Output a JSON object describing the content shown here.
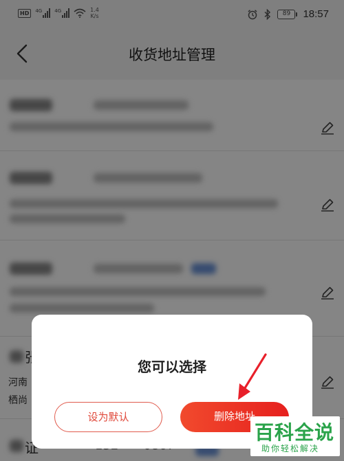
{
  "status_bar": {
    "hd_badge": "HD",
    "net1_tag": "4G",
    "net2_tag": "4G",
    "speed_value": "1.4",
    "speed_unit": "K/s",
    "battery_level": "89",
    "time": "18:57",
    "icons": [
      "hd-icon",
      "signal-icon",
      "wifi-icon",
      "alarm-icon",
      "bluetooth-icon",
      "battery-icon"
    ]
  },
  "header": {
    "title": "收货地址管理",
    "back_icon": "chevron-left-icon"
  },
  "address_list": {
    "partial_item_4": {
      "name_fragment": "张",
      "line1_fragment": "河南",
      "line2_fragment": "栖尚"
    },
    "partial_item_5": {
      "name_fragment": "证",
      "phone_fragment": "152****0867"
    },
    "edit_icon": "pencil-icon"
  },
  "dialog": {
    "title": "您可以选择",
    "default_label": "设为默认",
    "delete_label": "删除地址"
  },
  "watermark": {
    "title": "百科全说",
    "subtitle": "助你轻松解决"
  },
  "colors": {
    "accent_red": "#e6201e",
    "annotation_red": "#e8202a",
    "watermark_green": "#2aa34a"
  }
}
